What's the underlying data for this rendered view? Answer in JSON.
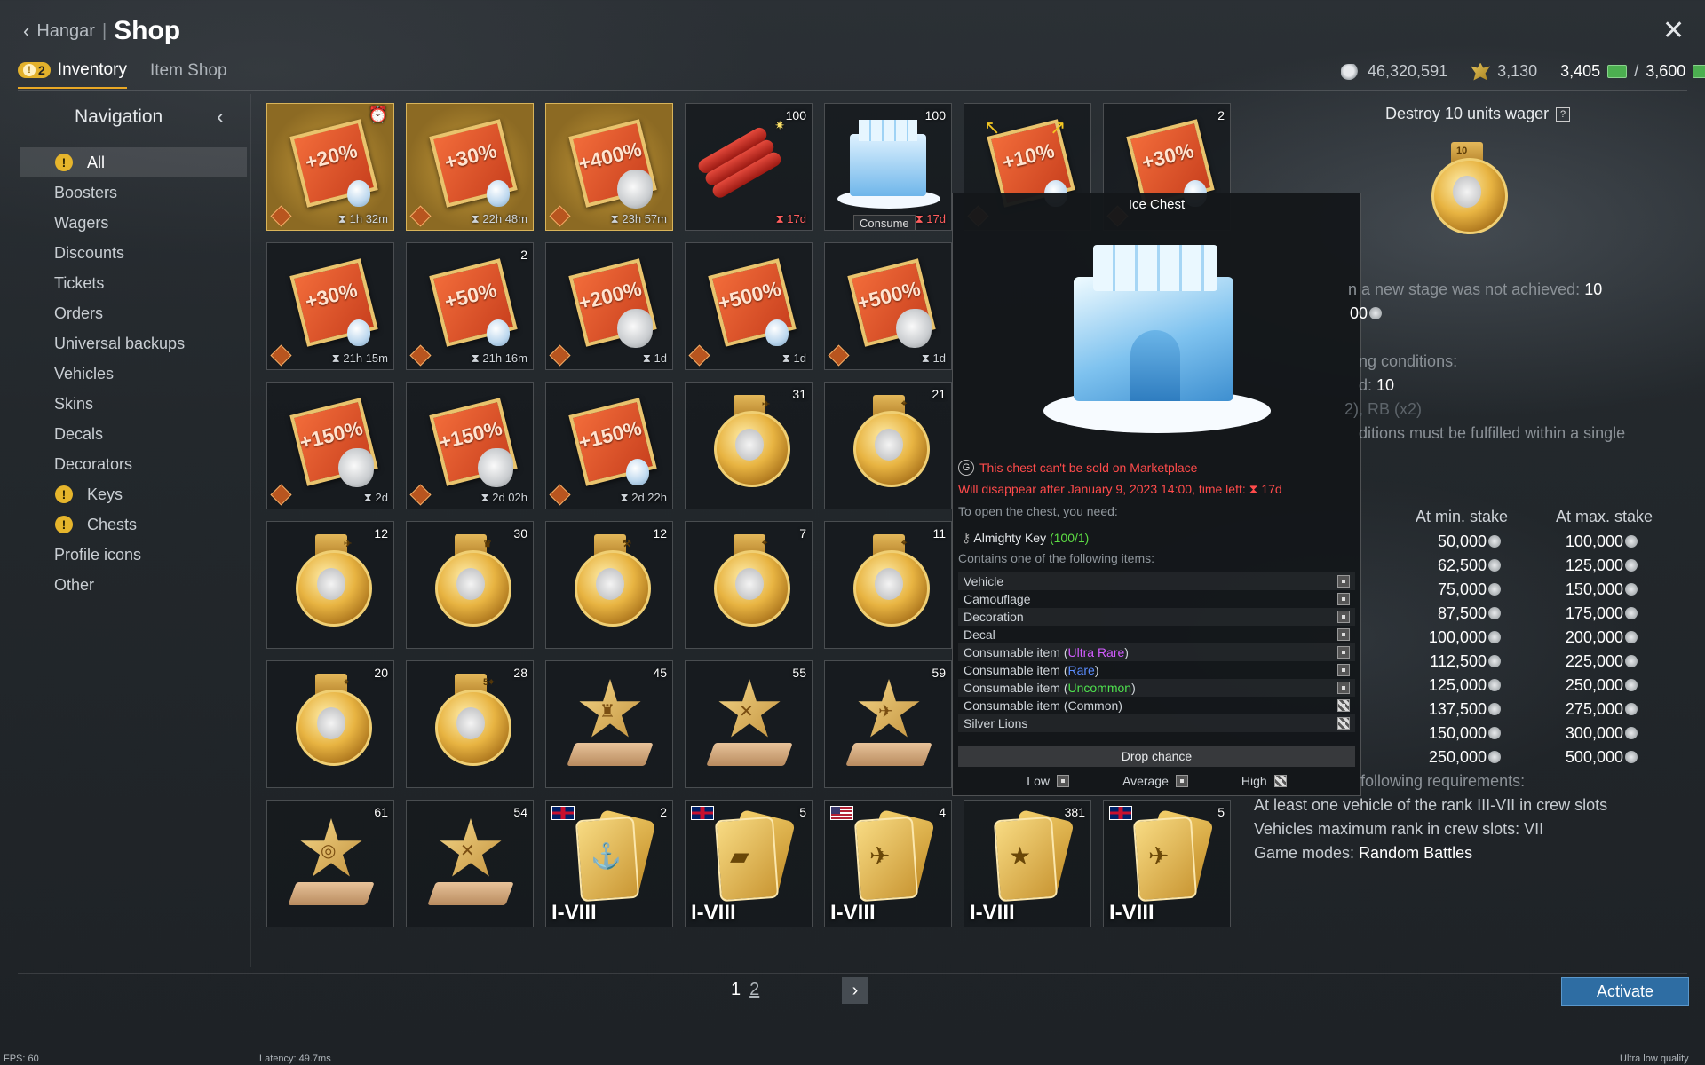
{
  "header": {
    "back_label": "Hangar",
    "separator": "|",
    "title": "Shop",
    "tabs": [
      {
        "label": "Inventory",
        "badge": "2",
        "active": true
      },
      {
        "label": "Item Shop",
        "active": false
      }
    ],
    "currency": {
      "silver": "46,320,591",
      "rp": "3,130",
      "gold": "3,405",
      "gold_sep": "/",
      "gold_max": "3,600"
    }
  },
  "sidebar": {
    "title": "Navigation",
    "items": [
      {
        "label": "All",
        "warn": true,
        "selected": true
      },
      {
        "label": "Boosters"
      },
      {
        "label": "Wagers"
      },
      {
        "label": "Discounts"
      },
      {
        "label": "Tickets"
      },
      {
        "label": "Orders"
      },
      {
        "label": "Universal backups"
      },
      {
        "label": "Vehicles"
      },
      {
        "label": "Skins"
      },
      {
        "label": "Decals"
      },
      {
        "label": "Decorators"
      },
      {
        "label": "Keys",
        "warn": true
      },
      {
        "label": "Chests",
        "warn": true
      },
      {
        "label": "Profile icons"
      },
      {
        "label": "Other"
      }
    ]
  },
  "grid": {
    "items": [
      {
        "kind": "booster",
        "pct": "+20%",
        "icon": "bulb",
        "timer": "⧗ 1h 32m",
        "highlight": true,
        "alarm": true
      },
      {
        "kind": "booster",
        "pct": "+30%",
        "icon": "bulb",
        "timer": "⧗ 22h 48m",
        "highlight": true
      },
      {
        "kind": "booster",
        "pct": "+400%",
        "icon": "lion",
        "timer": "⧗ 23h 57m",
        "highlight": true
      },
      {
        "kind": "dynamite",
        "count": "100",
        "timer": "⧗ 17d",
        "timer_red": true
      },
      {
        "kind": "icechest",
        "count": "100",
        "timer": "⧗ 17d",
        "timer_red": true,
        "consume": "Consume"
      },
      {
        "kind": "booster",
        "pct": "+10%",
        "icon": "bulb",
        "arrows": true
      },
      {
        "kind": "booster",
        "pct": "+30%",
        "icon": "bulb",
        "count": "2"
      },
      {
        "kind": "booster",
        "pct": "+30%",
        "icon": "bulb",
        "timer": "⧗ 21h 15m"
      },
      {
        "kind": "booster",
        "pct": "+50%",
        "icon": "bulb",
        "timer": "⧗ 21h 16m",
        "count": "2"
      },
      {
        "kind": "booster",
        "pct": "+200%",
        "icon": "lion",
        "timer": "⧗ 1d"
      },
      {
        "kind": "booster",
        "pct": "+500%",
        "icon": "bulb",
        "timer": "⧗ 1d"
      },
      {
        "kind": "booster",
        "pct": "+500%",
        "icon": "lion",
        "timer": "⧗ 1d"
      },
      {
        "kind": "booster",
        "pct": "+150%",
        "icon": "lion",
        "timer": "⧗ 2d"
      },
      {
        "kind": "booster",
        "pct": "+150%",
        "icon": "lion",
        "timer": "⧗ 2d 02h"
      },
      {
        "kind": "booster",
        "pct": "+150%",
        "icon": "bulb",
        "timer": "⧗ 2d 22h"
      },
      {
        "kind": "medal",
        "count": "31",
        "tab": "✈"
      },
      {
        "kind": "medal",
        "count": "21",
        "tab": "⌖"
      },
      {
        "kind": "medal",
        "count": "12",
        "tab": "✈"
      },
      {
        "kind": "medal",
        "count": "30",
        "tab": "♛"
      },
      {
        "kind": "medal",
        "count": "12",
        "tab": "⚒"
      },
      {
        "kind": "medal",
        "count": "7",
        "tab": "⌖"
      },
      {
        "kind": "medal",
        "count": "11",
        "tab": "⌖"
      },
      {
        "kind": "medal",
        "count": "20",
        "tab": "⌖"
      },
      {
        "kind": "medal",
        "count": "28",
        "tab": "5⌖"
      },
      {
        "kind": "trophy",
        "count": "45",
        "ico": "♜"
      },
      {
        "kind": "trophy",
        "count": "55",
        "ico": "✕"
      },
      {
        "kind": "trophy",
        "count": "59",
        "ico": "✈"
      },
      {
        "kind": "trophy",
        "count": "61",
        "ico": "◎"
      },
      {
        "kind": "trophy",
        "count": "54",
        "ico": "✕"
      },
      {
        "kind": "ticket",
        "count": "2",
        "flag": "uk",
        "tier": "I-VIII",
        "ic": "⚓"
      },
      {
        "kind": "ticket",
        "count": "5",
        "flag": "uk",
        "tier": "I-VIII",
        "ic": "▰"
      },
      {
        "kind": "ticket",
        "count": "4",
        "flag": "us",
        "tier": "I-VIII",
        "ic": "✈"
      },
      {
        "kind": "ticket",
        "count": "381",
        "tier": "I-VIII",
        "ic": "★"
      },
      {
        "kind": "ticket",
        "count": "5",
        "flag": "uk",
        "tier": "I-VIII",
        "ic": "✈"
      }
    ]
  },
  "tooltip": {
    "title": "Ice Chest",
    "warn": "This chest can't be sold on Marketplace",
    "disappear": "Will disappear after January 9, 2023 14:00, time left: ⧗ 17d",
    "need_label": "To open the chest, you need:",
    "key_label": "Almighty Key",
    "key_count": "(100/1)",
    "contains_label": "Contains one of the following items:",
    "rows": [
      {
        "pre": "Vehicle",
        "rarity": "",
        "post": "",
        "cls": ""
      },
      {
        "pre": "Camouflage",
        "rarity": "",
        "post": "",
        "cls": ""
      },
      {
        "pre": "Decoration",
        "rarity": "",
        "post": "",
        "cls": ""
      },
      {
        "pre": "Decal",
        "rarity": "",
        "post": "",
        "cls": ""
      },
      {
        "pre": "Consumable item (",
        "rarity": "Ultra Rare",
        "post": ")",
        "cls": "ur"
      },
      {
        "pre": "Consumable item (",
        "rarity": "Rare",
        "post": ")",
        "cls": "ra"
      },
      {
        "pre": "Consumable item (",
        "rarity": "Uncommon",
        "post": ")",
        "cls": "un"
      },
      {
        "pre": "Consumable item (Common)",
        "rarity": "",
        "post": "",
        "cls": "",
        "hi": true
      },
      {
        "pre": "Silver Lions",
        "rarity": "",
        "post": "",
        "cls": "",
        "hi": true
      }
    ],
    "drop_chance": "Drop chance",
    "legend": {
      "low": "Low",
      "avg": "Average",
      "high": "High"
    }
  },
  "right_panel": {
    "title": "Destroy 10 units wager",
    "help": "?",
    "medal_label": "10",
    "line1_pre": "n a new stage was not achieved:",
    "line1_val": "10",
    "line2": "00",
    "cond_label": "ng conditions:",
    "cond_d_pre": "d:",
    "cond_d_val": "10",
    "modes": "2), RB (x2)",
    "single": "ditions must be fulfilled within a single",
    "stake_min": "At min. stake",
    "stake_max": "At max. stake",
    "stakes": [
      {
        "min": "50,000",
        "max": "100,000"
      },
      {
        "min": "62,500",
        "max": "125,000"
      },
      {
        "min": "75,000",
        "max": "150,000"
      },
      {
        "min": "87,500",
        "max": "175,000"
      },
      {
        "min": "100,000",
        "max": "200,000"
      },
      {
        "min": "112,500",
        "max": "225,000"
      },
      {
        "min": "125,000",
        "max": "250,000"
      },
      {
        "min": "137,500",
        "max": "275,000"
      },
      {
        "min": "150,000",
        "max": "300,000"
      },
      {
        "min": "250,000",
        "max": "500,000"
      }
    ],
    "req_label": "following requirements:",
    "req1": "At least one vehicle of the rank III-VII in crew slots",
    "req2": "Vehicles maximum rank in crew slots: VII",
    "req3_pre": "Game modes:",
    "req3_val": "Random Battles"
  },
  "footer": {
    "page1": "1",
    "page2": "2",
    "activate": "Activate",
    "fps": "FPS: 60",
    "latency": "Latency: 49.7ms",
    "quality": "Ultra low quality"
  }
}
